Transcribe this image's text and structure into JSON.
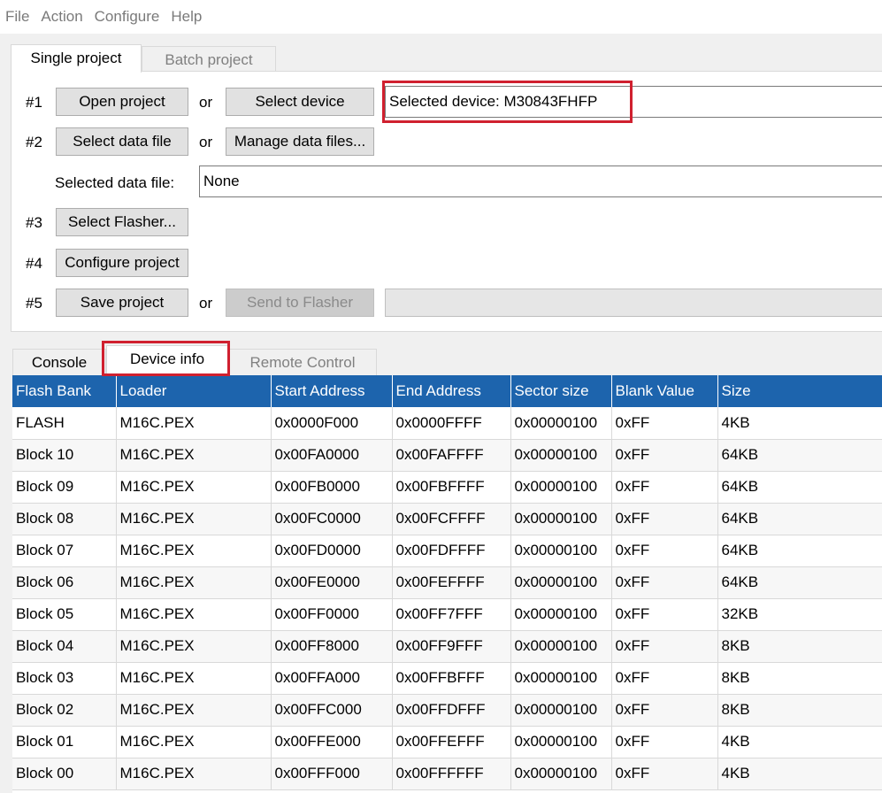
{
  "menu": [
    "File",
    "Action",
    "Configure",
    "Help"
  ],
  "project_tabs": {
    "single": "Single project",
    "batch": "Batch project"
  },
  "steps": {
    "s1": {
      "num": "#1",
      "open": "Open project",
      "or": "or",
      "select_device": "Select device",
      "device_value": "Selected device: M30843FHFP"
    },
    "s2": {
      "num": "#2",
      "select_data": "Select data file",
      "or": "or",
      "manage": "Manage data files..."
    },
    "data_file": {
      "label": "Selected data file:",
      "value": "None"
    },
    "s3": {
      "num": "#3",
      "select_flasher": "Select Flasher..."
    },
    "s4": {
      "num": "#4",
      "configure": "Configure project"
    },
    "s5": {
      "num": "#5",
      "save": "Save project",
      "or": "or",
      "send": "Send to Flasher",
      "value": ""
    }
  },
  "info_tabs": {
    "console": "Console",
    "device_info": "Device info",
    "remote": "Remote Control"
  },
  "table": {
    "columns": [
      "Flash Bank",
      "Loader",
      "Start Address",
      "End Address",
      "Sector size",
      "Blank Value",
      "Size"
    ],
    "rows": [
      [
        "FLASH",
        "M16C.PEX",
        "0x0000F000",
        "0x0000FFFF",
        "0x00000100",
        "0xFF",
        "4KB"
      ],
      [
        "Block 10",
        "M16C.PEX",
        "0x00FA0000",
        "0x00FAFFFF",
        "0x00000100",
        "0xFF",
        "64KB"
      ],
      [
        "Block 09",
        "M16C.PEX",
        "0x00FB0000",
        "0x00FBFFFF",
        "0x00000100",
        "0xFF",
        "64KB"
      ],
      [
        "Block 08",
        "M16C.PEX",
        "0x00FC0000",
        "0x00FCFFFF",
        "0x00000100",
        "0xFF",
        "64KB"
      ],
      [
        "Block 07",
        "M16C.PEX",
        "0x00FD0000",
        "0x00FDFFFF",
        "0x00000100",
        "0xFF",
        "64KB"
      ],
      [
        "Block 06",
        "M16C.PEX",
        "0x00FE0000",
        "0x00FEFFFF",
        "0x00000100",
        "0xFF",
        "64KB"
      ],
      [
        "Block 05",
        "M16C.PEX",
        "0x00FF0000",
        "0x00FF7FFF",
        "0x00000100",
        "0xFF",
        "32KB"
      ],
      [
        "Block 04",
        "M16C.PEX",
        "0x00FF8000",
        "0x00FF9FFF",
        "0x00000100",
        "0xFF",
        "8KB"
      ],
      [
        "Block 03",
        "M16C.PEX",
        "0x00FFA000",
        "0x00FFBFFF",
        "0x00000100",
        "0xFF",
        "8KB"
      ],
      [
        "Block 02",
        "M16C.PEX",
        "0x00FFC000",
        "0x00FFDFFF",
        "0x00000100",
        "0xFF",
        "8KB"
      ],
      [
        "Block 01",
        "M16C.PEX",
        "0x00FFE000",
        "0x00FFEFFF",
        "0x00000100",
        "0xFF",
        "4KB"
      ],
      [
        "Block 00",
        "M16C.PEX",
        "0x00FFF000",
        "0x00FFFFFF",
        "0x00000100",
        "0xFF",
        "4KB"
      ]
    ]
  },
  "colors": {
    "header_bg": "#1d64ad",
    "highlight": "#d0202f"
  }
}
